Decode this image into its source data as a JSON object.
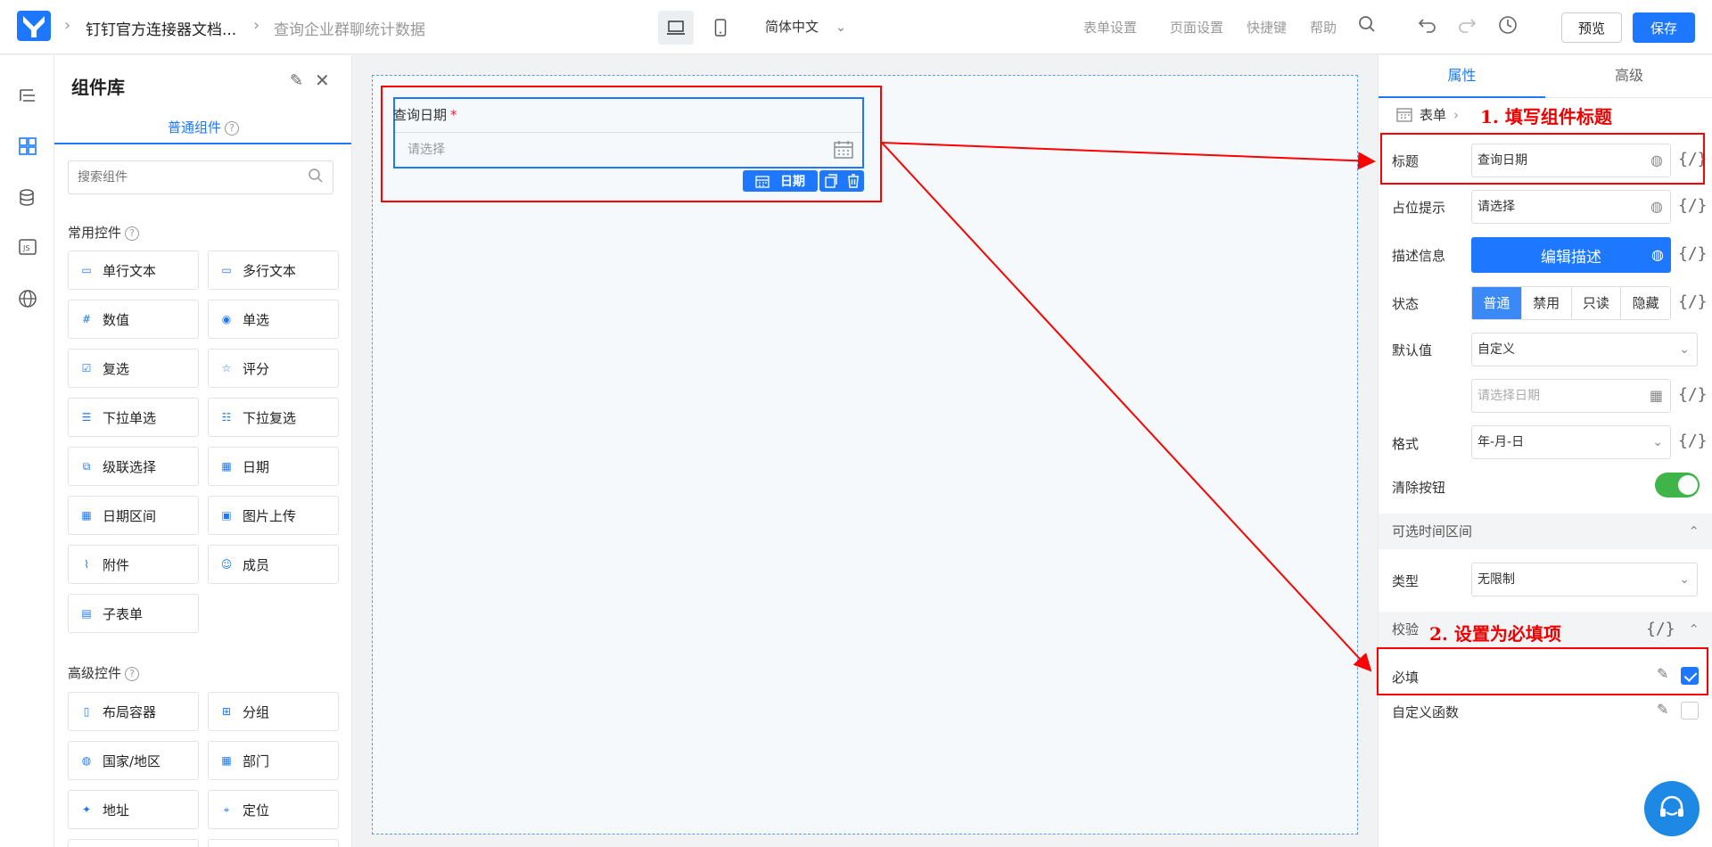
{
  "header": {
    "breadcrumb": [
      "钉钉官方连接器文档...",
      "查询企业群聊统计数据"
    ],
    "language": "简体中文",
    "links": [
      "表单设置",
      "页面设置",
      "快捷键",
      "帮助"
    ],
    "preview_label": "预览",
    "save_label": "保存"
  },
  "library": {
    "title": "组件库",
    "tab": "普通组件",
    "search_placeholder": "搜索组件",
    "common_section": "常用控件",
    "common_items": [
      "单行文本",
      "多行文本",
      "数值",
      "单选",
      "复选",
      "评分",
      "下拉单选",
      "下拉复选",
      "级联选择",
      "日期",
      "日期区间",
      "图片上传",
      "附件",
      "成员",
      "子表单"
    ],
    "advanced_section": "高级控件",
    "advanced_items": [
      "布局容器",
      "分组",
      "国家/地区",
      "部门",
      "地址",
      "定位"
    ]
  },
  "canvas": {
    "field_label": "查询日期",
    "required_mark": "*",
    "placeholder": "请选择",
    "tag_label": "日期"
  },
  "annotations": {
    "step1": "1. 填写组件标题",
    "step2": "2. 设置为必填项"
  },
  "props": {
    "tabs": [
      "属性",
      "高级"
    ],
    "crumb_root": "表单",
    "title_label": "标题",
    "title_value": "查询日期",
    "placeholder_label": "占位提示",
    "placeholder_value": "请选择",
    "desc_label": "描述信息",
    "desc_button": "编辑描述",
    "state_label": "状态",
    "state_options": [
      "普通",
      "禁用",
      "只读",
      "隐藏"
    ],
    "default_label": "默认值",
    "default_mode": "自定义",
    "default_date_placeholder": "请选择日期",
    "format_label": "格式",
    "format_value": "年-月-日",
    "clear_label": "清除按钮",
    "clear_on": true,
    "range_section": "可选时间区间",
    "type_label": "类型",
    "type_value": "无限制",
    "validate_section": "校验",
    "required_label": "必填",
    "required_checked": true,
    "custom_fn_label": "自定义函数",
    "custom_fn_checked": false,
    "expr_symbol": "{/}"
  },
  "colors": {
    "primary": "#1e78ff",
    "annotation": "#ff0000",
    "toggle_on": "#3fb549"
  }
}
